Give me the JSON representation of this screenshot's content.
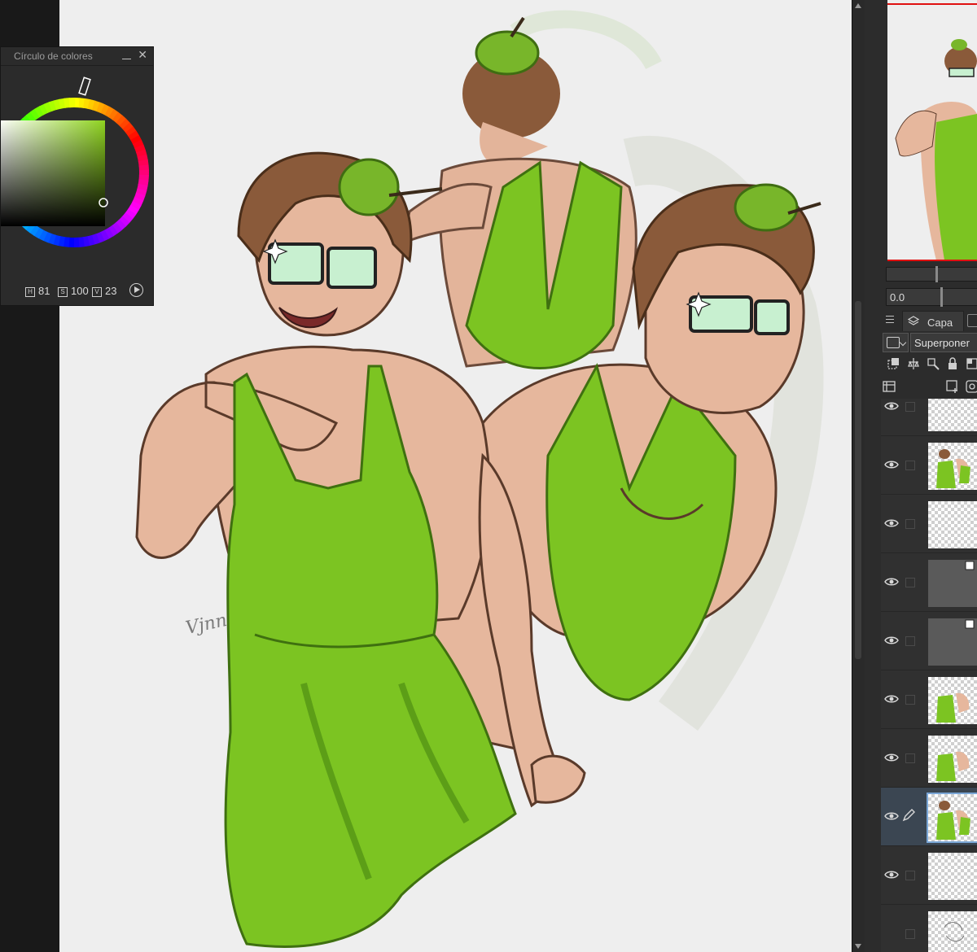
{
  "color_panel": {
    "title": "Círculo de colores",
    "close_glyph": "✕",
    "hsv": {
      "h_label": "H",
      "h_value": "81",
      "s_label": "S",
      "s_value": "100",
      "v_label": "V",
      "v_value": "23"
    },
    "selected_color": "#3a5a0e",
    "icons": [
      "minimize-icon",
      "close-icon",
      "play-icon"
    ]
  },
  "navigator": {
    "rotation_value": "0.0"
  },
  "layer_panel": {
    "tab_label": "Capa",
    "blend_mode": "Superponer",
    "layers": [
      {
        "visible": true,
        "thumb": "transparent",
        "selected": false
      },
      {
        "visible": true,
        "thumb": "figure",
        "selected": false
      },
      {
        "visible": true,
        "thumb": "transparent",
        "selected": false
      },
      {
        "visible": true,
        "thumb": "gray-folder",
        "selected": false
      },
      {
        "visible": true,
        "thumb": "gray-folder",
        "selected": false
      },
      {
        "visible": true,
        "thumb": "figure-partial",
        "selected": false
      },
      {
        "visible": true,
        "thumb": "figure-partial",
        "selected": false
      },
      {
        "visible": true,
        "thumb": "figure",
        "selected": true
      },
      {
        "visible": true,
        "thumb": "transparent",
        "selected": false
      },
      {
        "visible": false,
        "thumb": "sketch",
        "selected": false
      }
    ]
  },
  "canvas": {
    "signature": "Vjnn",
    "accent_green": "#79b21a",
    "skin": "#e6b79d",
    "hair": "#8a5a3a"
  }
}
